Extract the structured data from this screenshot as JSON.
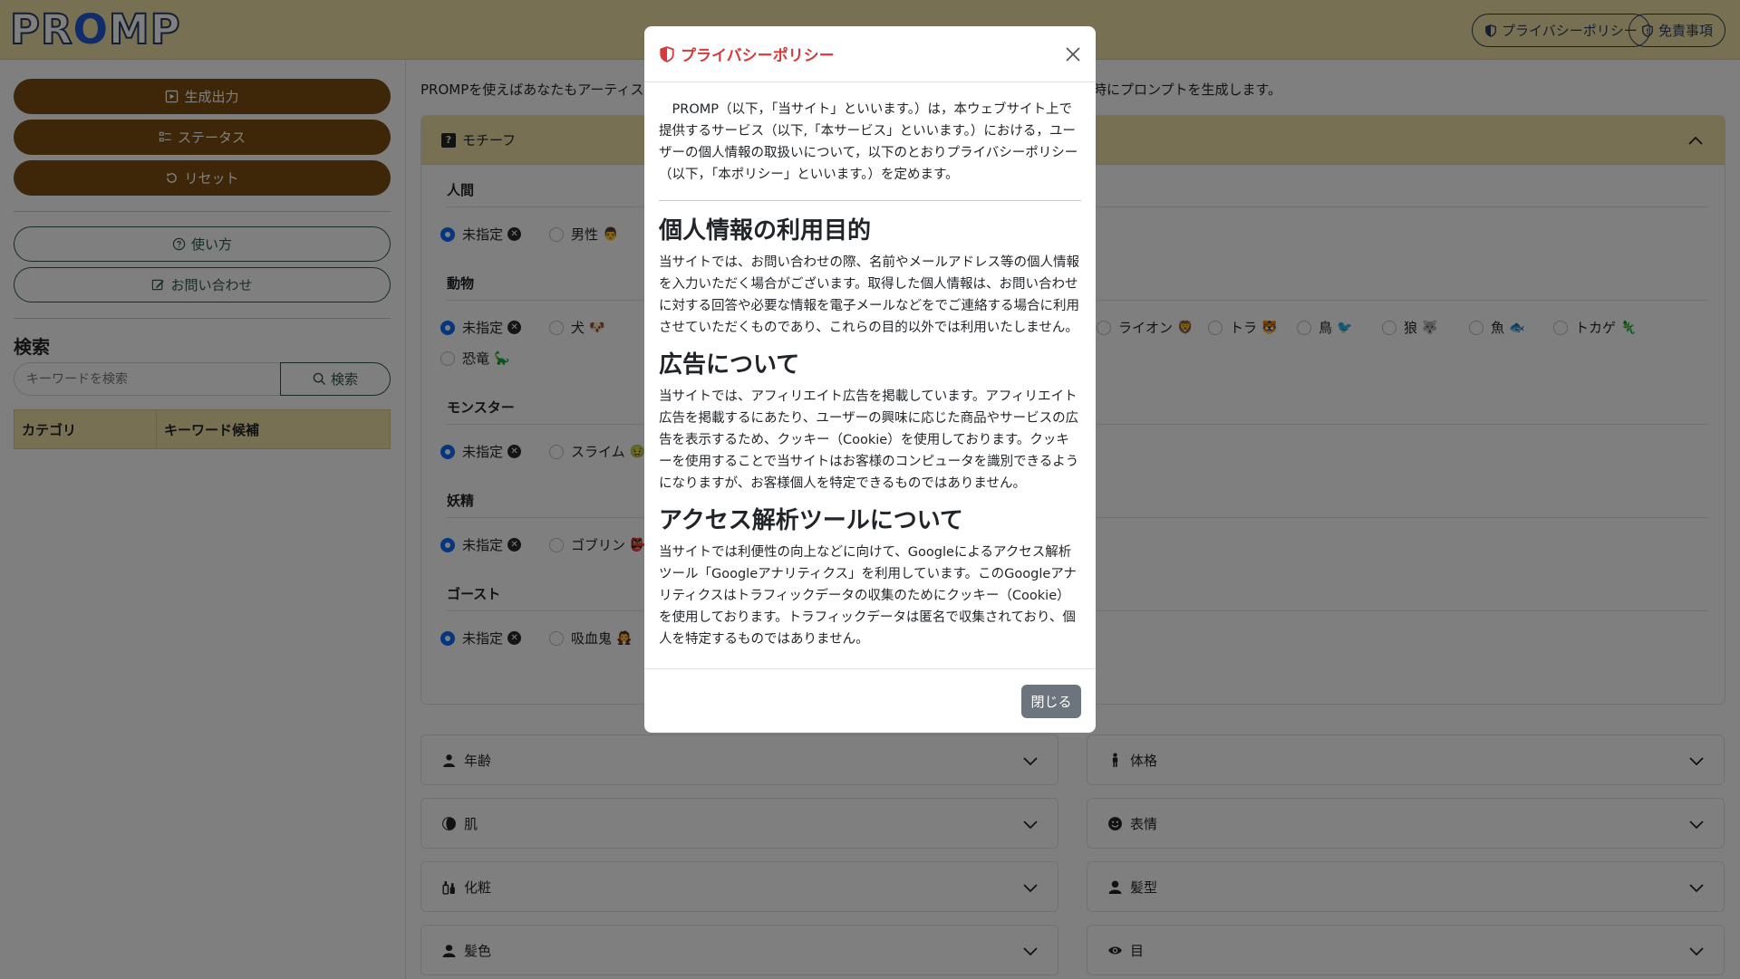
{
  "header": {
    "logo_pre": "PR",
    "logo_o": "O",
    "logo_post": "MP",
    "privacy_label": "プライバシーポリシー",
    "disclaimer_label": "免責事項"
  },
  "sidebar": {
    "generate_label": "生成出力",
    "status_label": "ステータス",
    "reset_label": "リセット",
    "howto_label": "使い方",
    "contact_label": "お問い合わせ",
    "search_title": "検索",
    "search_placeholder": "キーワードを検索",
    "search_button": "検索",
    "table_headers": [
      "カテゴリ",
      "キーワード候補"
    ]
  },
  "main": {
    "intro_left": "PROMPを使えばあなたもアーティストに",
    "intro_right": "時にプロンプトを生成します。",
    "motif_title": "モチーフ",
    "groups": [
      {
        "label": "人間",
        "options": [
          {
            "label": "未指定"
          },
          {
            "label": "男性",
            "emoji": "👨"
          }
        ]
      },
      {
        "label": "動物",
        "options": [
          {
            "label": "未指定"
          },
          {
            "label": "犬",
            "emoji": "🐶"
          }
        ],
        "right_options": [
          {
            "label": "ライオン",
            "emoji": "🦁"
          },
          {
            "label": "トラ",
            "emoji": "🐯"
          },
          {
            "label": "鳥",
            "emoji": "🐦"
          },
          {
            "label": "狼",
            "emoji": "🐺"
          },
          {
            "label": "魚",
            "emoji": "🐟"
          },
          {
            "label": "トカゲ",
            "emoji": "🦎"
          }
        ],
        "extra_option": {
          "label": "恐竜",
          "emoji": "🦕"
        }
      },
      {
        "label": "モンスター",
        "options": [
          {
            "label": "未指定"
          },
          {
            "label": "スライム",
            "emoji": "🤢"
          }
        ]
      },
      {
        "label": "妖精",
        "options": [
          {
            "label": "未指定"
          },
          {
            "label": "ゴブリン",
            "emoji": "👺"
          }
        ]
      },
      {
        "label": "ゴースト",
        "options": [
          {
            "label": "未指定"
          },
          {
            "label": "吸血鬼",
            "emoji": "🧛"
          }
        ]
      }
    ],
    "accordions": [
      {
        "label": "年齢",
        "icon": "person-icon"
      },
      {
        "label": "体格",
        "icon": "standing-person-icon"
      },
      {
        "label": "肌",
        "icon": "skin-icon"
      },
      {
        "label": "表情",
        "icon": "smile-icon"
      },
      {
        "label": "化粧",
        "icon": "makeup-icon"
      },
      {
        "label": "髪型",
        "icon": "hair-person-icon"
      },
      {
        "label": "髪色",
        "icon": "hair-color-icon"
      },
      {
        "label": "目",
        "icon": "eye-icon"
      }
    ]
  },
  "modal": {
    "title": "プライバシーポリシー",
    "intro": "PROMP（以下，「当サイト」といいます。）は，本ウェブサイト上で提供するサービス（以下,「本サービス」といいます。）における，ユーザーの個人情報の取扱いについて，以下のとおりプライバシーポリシー（以下，「本ポリシー」といいます。）を定めます。",
    "sections": [
      {
        "heading": "個人情報の利用目的",
        "text": "当サイトでは、お問い合わせの際、名前やメールアドレス等の個人情報を入力いただく場合がございます。取得した個人情報は、お問い合わせに対する回答や必要な情報を電子メールなどをでご連絡する場合に利用させていただくものであり、これらの目的以外では利用いたしません。"
      },
      {
        "heading": "広告について",
        "text": "当サイトでは、アフィリエイト広告を掲載しています。アフィリエイト広告を掲載するにあたり、ユーザーの興味に応じた商品やサービスの広告を表示するため、クッキー（Cookie）を使用しております。クッキーを使用することで当サイトはお客様のコンピュータを識別できるようになりますが、お客様個人を特定できるものではありません。"
      },
      {
        "heading": "アクセス解析ツールについて",
        "text": "当サイトでは利便性の向上などに向けて、Googleによるアクセス解析ツール「Googleアナリティクス」を利用しています。このGoogleアナリティクスはトラフィックデータの収集のためにクッキー（Cookie）を使用しております。トラフィックデータは匿名で収集されており、個人を特定するものではありません。"
      }
    ],
    "close_label": "閉じる"
  },
  "colors": {
    "header_bg": "#f1e1a6",
    "primary_brown": "#7a4e10",
    "outline_green": "#2e5a45",
    "modal_title_red": "#d63a3a",
    "radio_blue": "#0d6efd"
  }
}
